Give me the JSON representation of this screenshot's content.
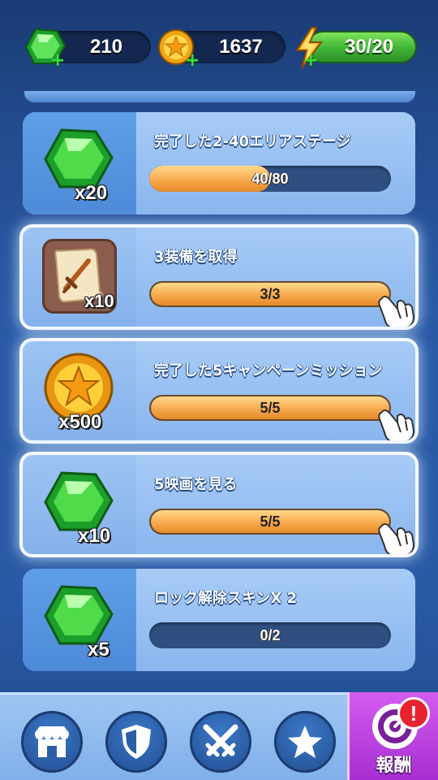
{
  "resources": {
    "gems": {
      "value": "210",
      "icon": "green-gem-icon"
    },
    "coins": {
      "value": "1637",
      "icon": "gold-star-coin-icon"
    },
    "energy": {
      "value": "30/20",
      "icon": "lightning-bolt-icon"
    },
    "plus_symbol": "+"
  },
  "quests": [
    {
      "title": "完了した2-40エリアステージ",
      "reward_count": "x20",
      "reward_icon": "green-gem-icon",
      "progress_text": "40/80",
      "progress": 0.5,
      "completed": false
    },
    {
      "title": "3装備を取得",
      "reward_count": "x10",
      "reward_icon": "equipment-scroll-icon",
      "progress_text": "3/3",
      "progress": 1.0,
      "completed": true
    },
    {
      "title": "完了した5キャンペーンミッション",
      "reward_count": "x500",
      "reward_icon": "gold-star-coin-icon",
      "progress_text": "5/5",
      "progress": 1.0,
      "completed": true
    },
    {
      "title": "5映画を見る",
      "reward_count": "x10",
      "reward_icon": "green-gem-icon",
      "progress_text": "5/5",
      "progress": 1.0,
      "completed": true
    },
    {
      "title": "ロック解除スキンX 2",
      "reward_count": "x5",
      "reward_icon": "green-gem-icon",
      "progress_text": "0/2",
      "progress": 0.0,
      "completed": false
    }
  ],
  "nav": {
    "items": [
      {
        "icon": "shop-icon"
      },
      {
        "icon": "shield-icon"
      },
      {
        "icon": "crossed-swords-icon"
      },
      {
        "icon": "star-icon"
      }
    ],
    "active": {
      "icon": "target-icon",
      "label": "報酬",
      "badge": "!"
    }
  },
  "colors": {
    "background": "#2a5aa6",
    "card": "#a7cbf6",
    "progress_fill": "#f7a94d",
    "active_tab": "#c048e6",
    "badge": "#e8232f"
  }
}
